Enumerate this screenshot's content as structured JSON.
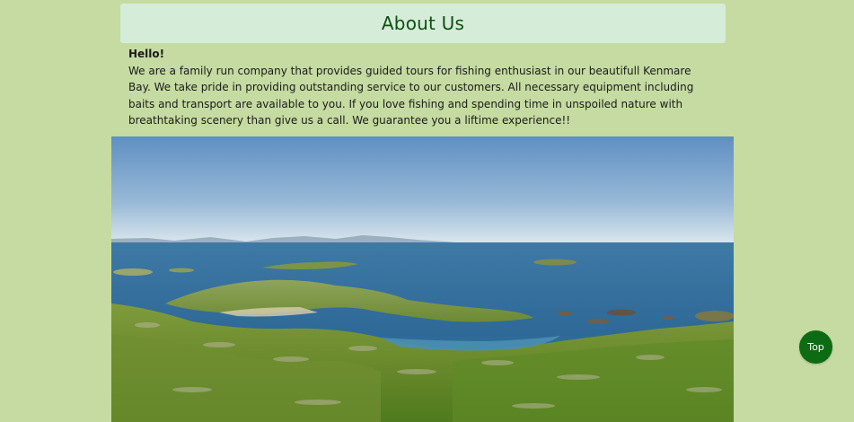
{
  "section": {
    "title": "About Us",
    "greeting": "Hello!",
    "body": "We are a family run company that provides guided tours for fishing enthusiast in our beautifull Kenmare Bay. We take pride in providing outstanding service to our customers. All necessary equipment including baits and transport are available to you. If you love fishing and spending time in unspoiled nature with breathtaking scenery than give us a call. We guarantee you a liftime experience!!"
  },
  "image": {
    "alt_subject": "coastal bay landscape photo"
  },
  "scroll_top_button": {
    "label": "Top",
    "color": "#0d6b14"
  },
  "colors": {
    "page_background": "#c5dba1",
    "header_background": "#d5ecd9",
    "title_text": "#0f4f12"
  }
}
